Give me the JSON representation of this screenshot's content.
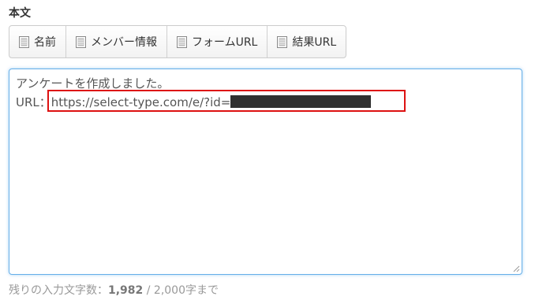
{
  "section_label": "本文",
  "insert_buttons": [
    {
      "label": "名前",
      "icon": "document-icon"
    },
    {
      "label": "メンバー情報",
      "icon": "document-icon"
    },
    {
      "label": "フォームURL",
      "icon": "document-icon"
    },
    {
      "label": "結果URL",
      "icon": "document-icon"
    }
  ],
  "editor": {
    "line1": "アンケートを作成しました。",
    "line2_prefix": "URL：",
    "line2_url": "https://select-type.com/e/?id=",
    "line2_masked": "[redacted]"
  },
  "counter": {
    "prefix": "残りの入力文字数：",
    "remaining": "1,982",
    "separator": " / ",
    "max": "2,000字まで"
  },
  "colors": {
    "focus_border": "#66afe9",
    "highlight": "#dd1111",
    "redaction": "#303030"
  }
}
